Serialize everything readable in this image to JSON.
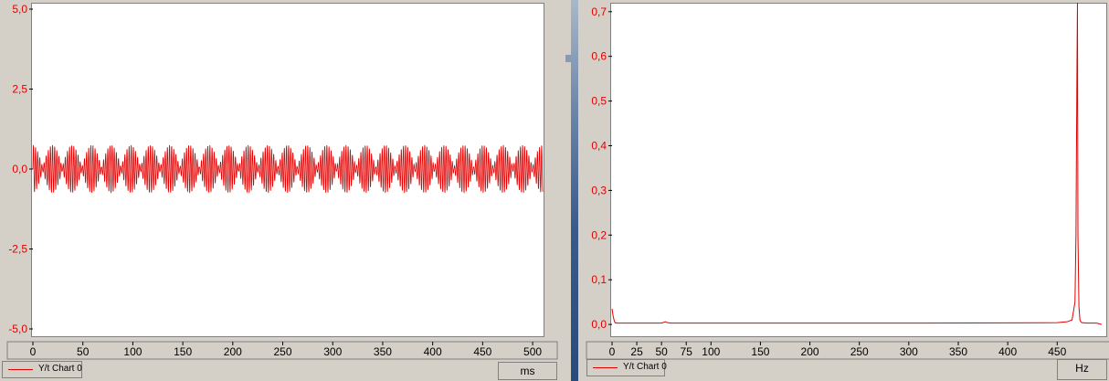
{
  "colors": {
    "signal": "#e00000",
    "tick_text": "#e00000",
    "x_tick_text": "#000000"
  },
  "left_chart": {
    "legend": "Y/t Chart 0",
    "unit": "ms"
  },
  "right_chart": {
    "legend": "Y/t Chart 0",
    "unit": "Hz"
  },
  "chart_data": [
    {
      "type": "line",
      "title": "",
      "xlabel": "ms",
      "ylabel": "",
      "xlim": [
        0,
        510
      ],
      "ylim": [
        -5.2,
        5.2
      ],
      "x_ticks": [
        0,
        50,
        100,
        150,
        200,
        250,
        300,
        350,
        400,
        450,
        500
      ],
      "y_ticks": [
        5.0,
        2.5,
        0.0,
        -2.5,
        -5.0
      ],
      "y_tick_labels": [
        "5,0",
        "2,5",
        "0,0",
        "-2,5",
        "-5,0"
      ],
      "grid": false,
      "legend": "bottom-left",
      "series": [
        {
          "name": "Y/t Chart 0",
          "carrier_hz": 470,
          "envelope_period_ms": 19.6,
          "amplitude_max": 0.75,
          "amplitude_min": 0.05
        }
      ]
    },
    {
      "type": "line",
      "title": "",
      "xlabel": "Hz",
      "ylabel": "",
      "xlim": [
        0,
        495
      ],
      "ylim": [
        -0.01,
        0.72
      ],
      "x_ticks": [
        0,
        25,
        50,
        75,
        100,
        150,
        200,
        250,
        300,
        350,
        400,
        450
      ],
      "y_ticks": [
        0.7,
        0.6,
        0.5,
        0.4,
        0.3,
        0.2,
        0.1,
        0.0
      ],
      "y_tick_labels": [
        "0,7",
        "0,6",
        "0,5",
        "0,4",
        "0,3",
        "0,2",
        "0,1",
        "0,0"
      ],
      "grid": false,
      "legend": "bottom-left",
      "series": [
        {
          "name": "Y/t Chart 0",
          "x": [
            0,
            1,
            2,
            3,
            5,
            10,
            50,
            54,
            56,
            60,
            100,
            300,
            450,
            460,
            465,
            468,
            469,
            470,
            470.5,
            471,
            472,
            473,
            474,
            475,
            480,
            490,
            495
          ],
          "y": [
            0.035,
            0.02,
            0.01,
            0.004,
            0.003,
            0.003,
            0.003,
            0.006,
            0.004,
            0.003,
            0.003,
            0.003,
            0.004,
            0.006,
            0.01,
            0.05,
            0.2,
            0.57,
            0.72,
            0.2,
            0.04,
            0.01,
            0.006,
            0.004,
            0.003,
            0.003,
            0.0
          ]
        }
      ]
    }
  ]
}
